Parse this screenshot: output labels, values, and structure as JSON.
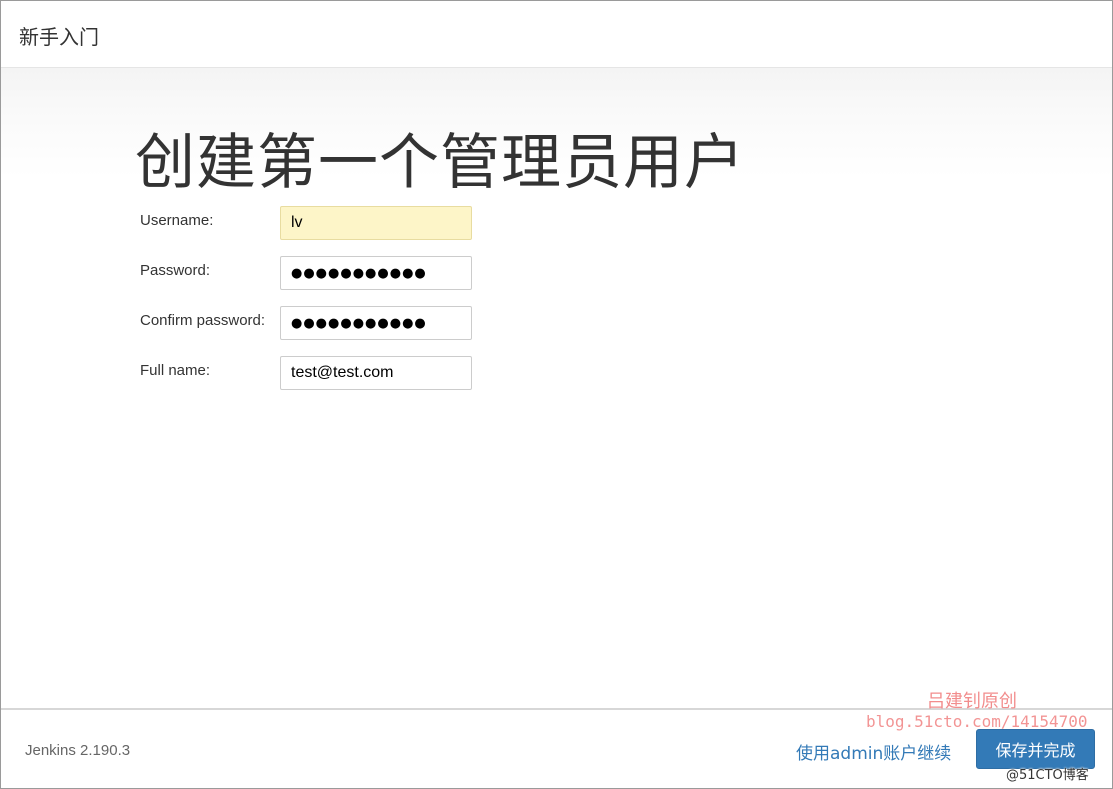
{
  "header": {
    "title": "新手入门"
  },
  "main": {
    "title": "创建第一个管理员用户",
    "fields": [
      {
        "label": "Username:",
        "value": "lv",
        "type": "text"
      },
      {
        "label": "Password:",
        "value": "●●●●●●●●●●●",
        "type": "password"
      },
      {
        "label": "Confirm password:",
        "value": "●●●●●●●●●●●",
        "type": "password"
      },
      {
        "label": "Full name:",
        "value": "test@test.com",
        "type": "text"
      }
    ]
  },
  "footer": {
    "version": "Jenkins 2.190.3",
    "continue_link": "使用admin账户继续",
    "save_button": "保存并完成"
  },
  "watermark": {
    "name": "吕建钊原创",
    "url": "blog.51cto.com/14154700",
    "site": "@51CTO博客"
  },
  "colors": {
    "primary": "#337ab7",
    "autofill": "#fdf5c8",
    "watermark": "#f07a7a"
  }
}
